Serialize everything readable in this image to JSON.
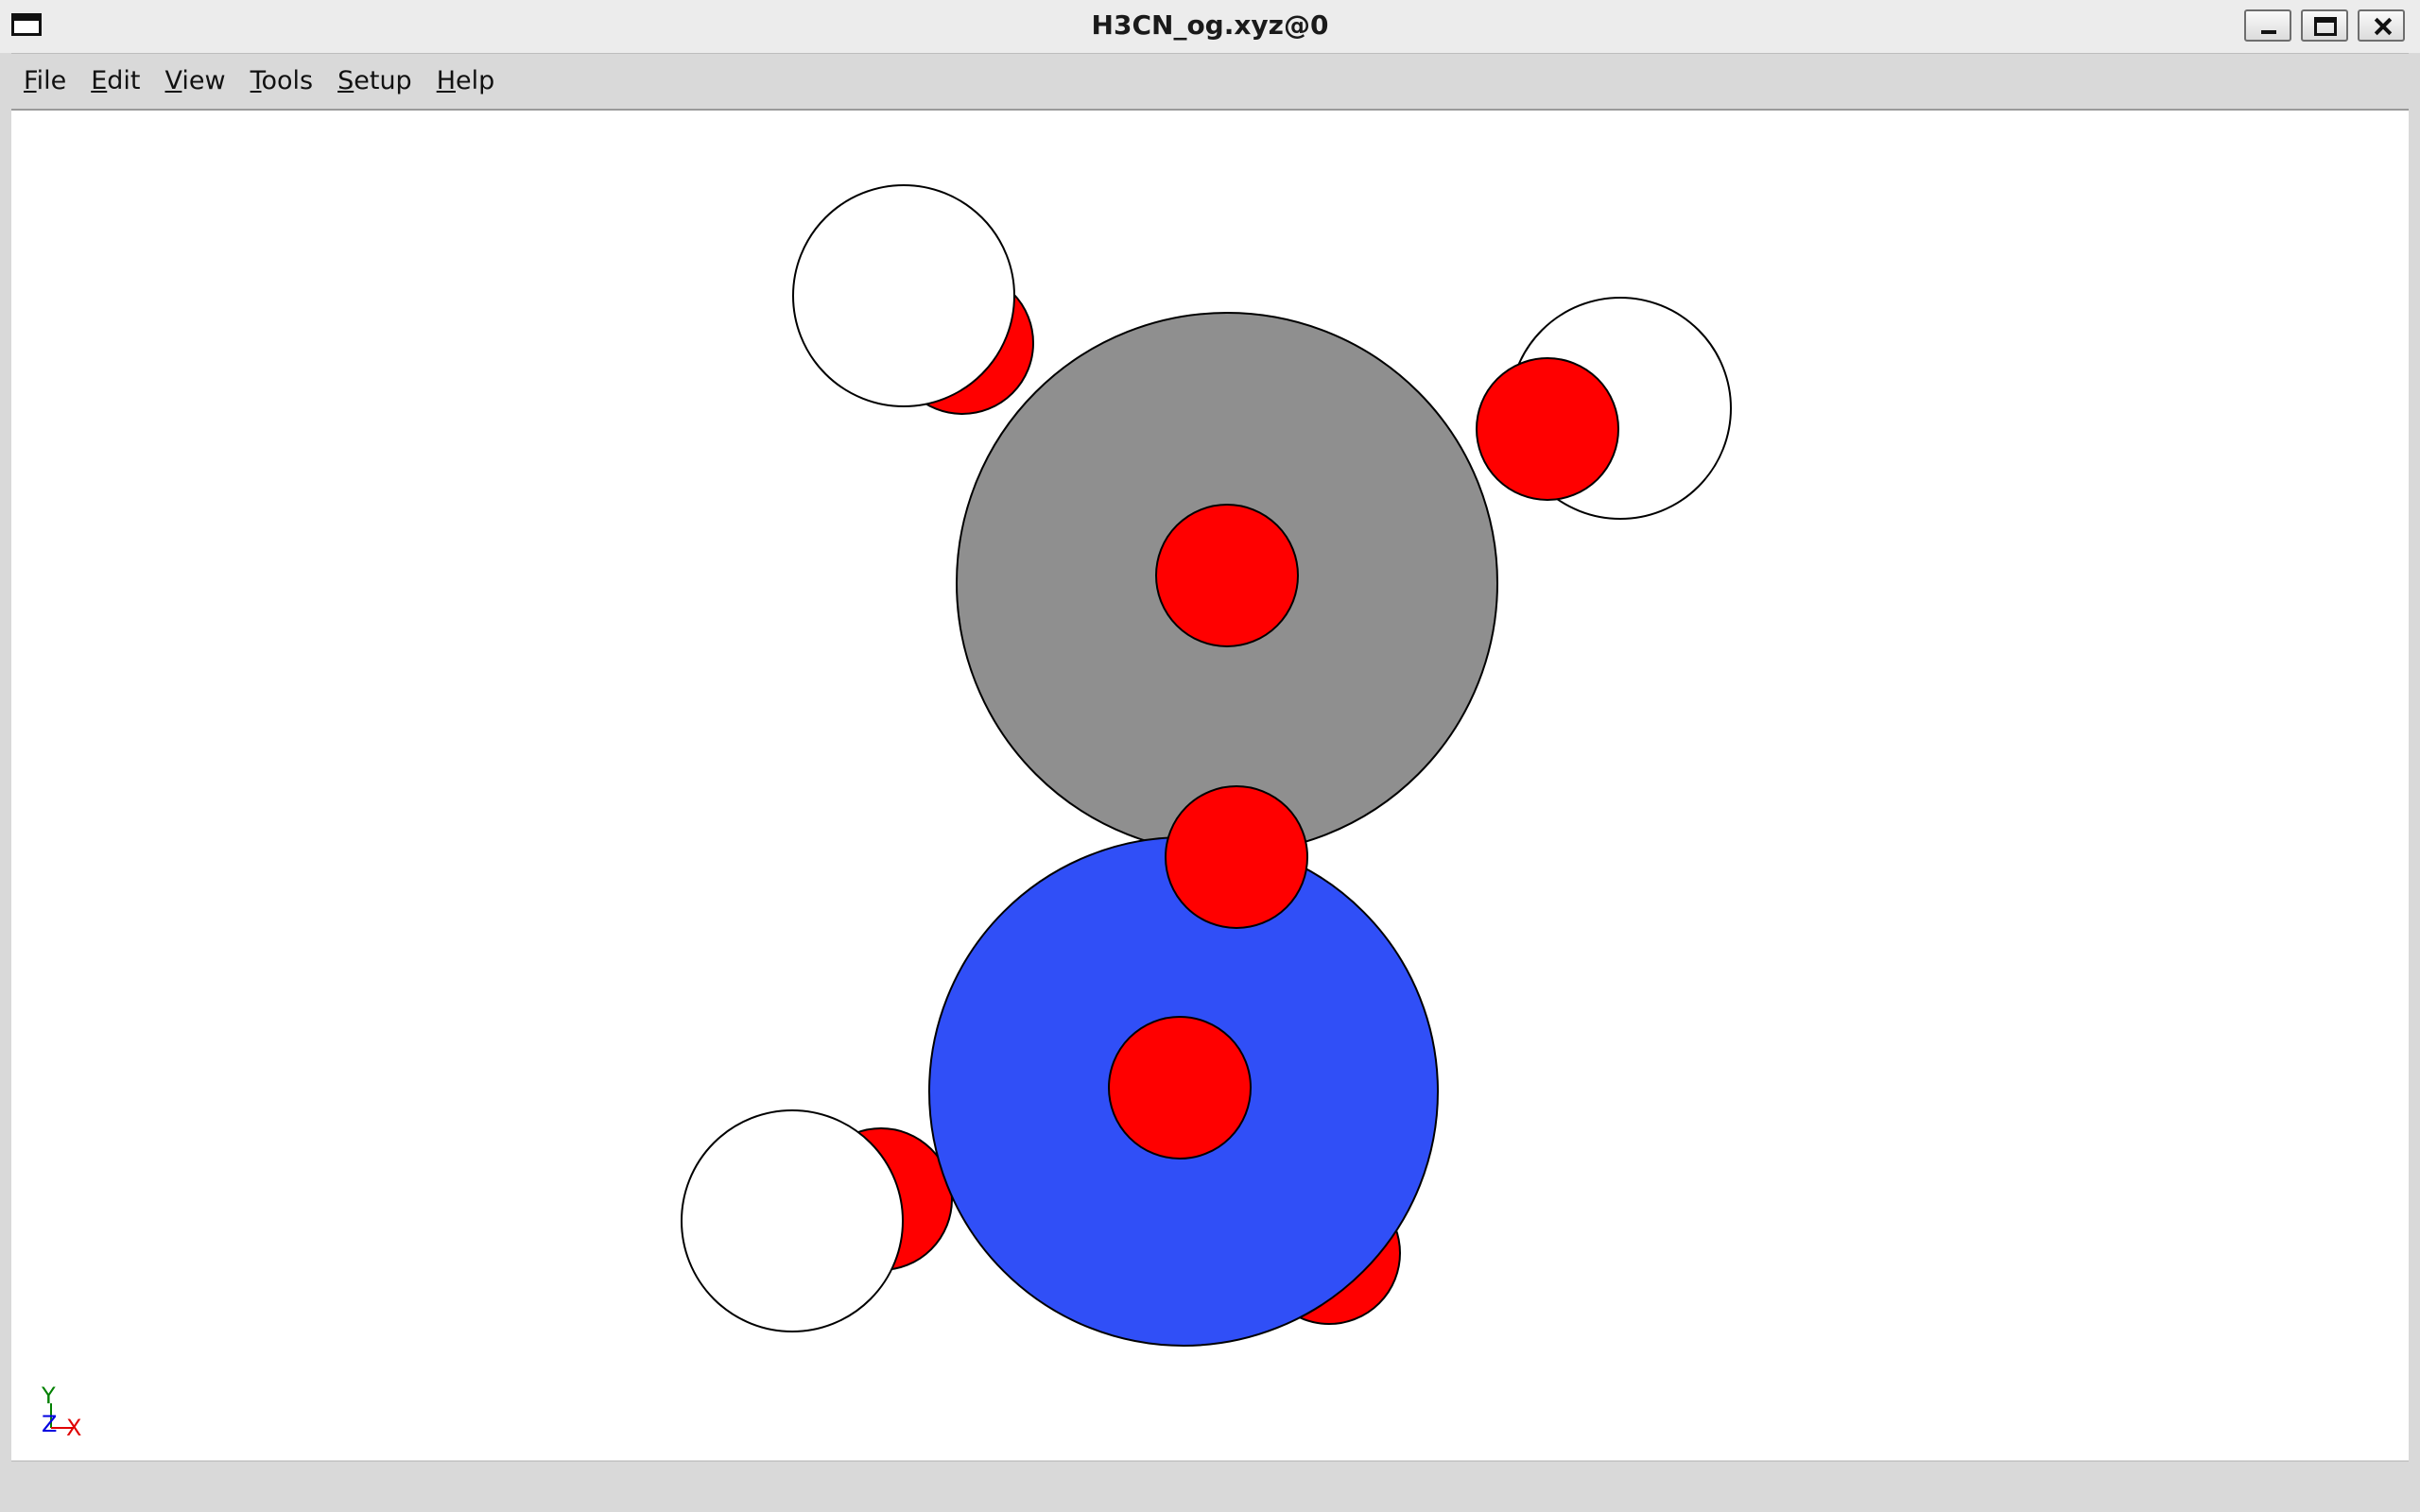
{
  "window": {
    "title": "H3CN_og.xyz@0"
  },
  "menubar": {
    "items": [
      {
        "label": "File",
        "mnemonic": "F",
        "rest": "ile",
        "name": "menu-file"
      },
      {
        "label": "Edit",
        "mnemonic": "E",
        "rest": "dit",
        "name": "menu-edit"
      },
      {
        "label": "View",
        "mnemonic": "V",
        "rest": "iew",
        "name": "menu-view"
      },
      {
        "label": "Tools",
        "mnemonic": "T",
        "rest": "ools",
        "name": "menu-tools"
      },
      {
        "label": "Setup",
        "mnemonic": "S",
        "rest": "etup",
        "name": "menu-setup"
      },
      {
        "label": "Help",
        "mnemonic": "H",
        "rest": "elp",
        "name": "menu-help"
      }
    ]
  },
  "colors": {
    "carbon": "#8f8f8f",
    "nitrogen": "#304ff7",
    "hydrogen": "#ffffff",
    "marker": "#ff0000",
    "axis_x": "#e00000",
    "axis_y": "#008000",
    "axis_z": "#0000e0"
  },
  "axes": {
    "x": "X",
    "y": "Y",
    "z": "Z"
  }
}
